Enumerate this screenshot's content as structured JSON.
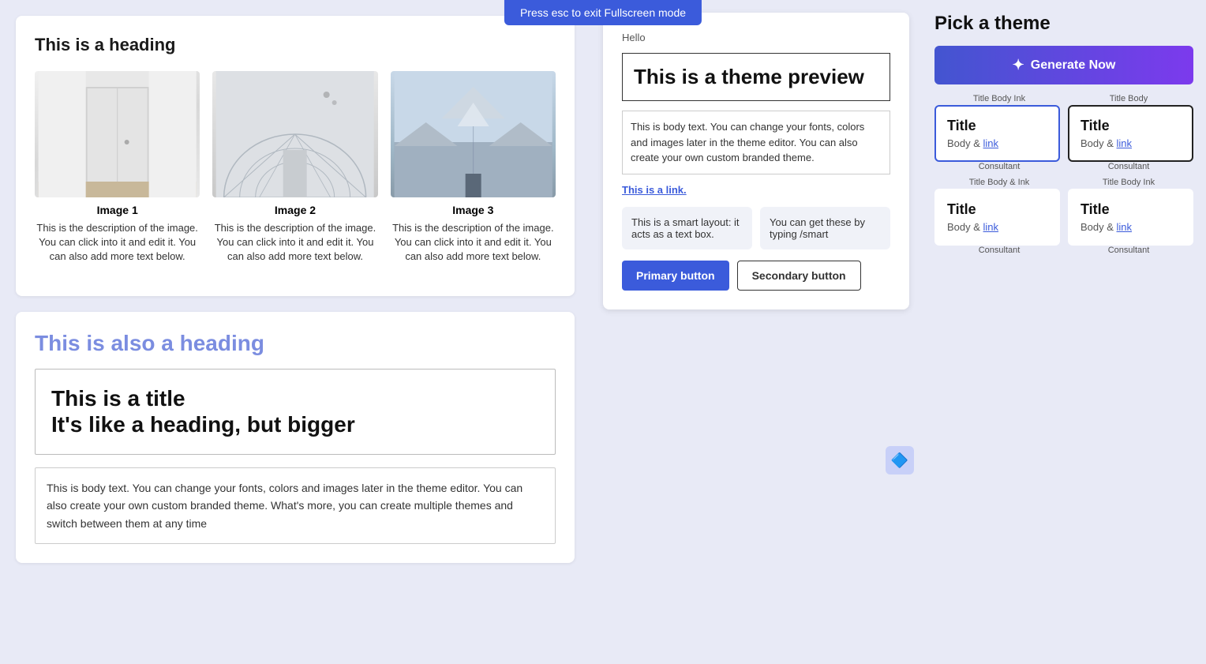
{
  "topbar": {
    "message": "Press esc to exit Fullscreen mode"
  },
  "editor": {
    "card1": {
      "heading": "This is a heading",
      "images": [
        {
          "label": "Image 1",
          "description": "This is the description of the image. You can click into it and edit it. You can also add more text below.",
          "type": "door"
        },
        {
          "label": "Image 2",
          "description": "This is the description of the image. You can click into it and edit it. You can also add more text below.",
          "type": "arch"
        },
        {
          "label": "Image 3",
          "description": "This is the description of the image. You can click into it and edit it. You can also add more text below.",
          "type": "mountain"
        }
      ]
    },
    "card2": {
      "also_heading": "This is also a heading",
      "title_line1": "This is a title",
      "title_line2": "It's like a heading, but bigger",
      "body_text": "This is body text. You can change your fonts, colors and images later in the theme editor. You can also create your own custom branded theme. What's more, you can create multiple themes and switch between them at any time"
    }
  },
  "right_panel": {
    "title": "Pick a theme",
    "generate_btn": "Generate Now",
    "themes": [
      {
        "title": "Title",
        "body": "Body & link",
        "label": "Consultant",
        "selected": true,
        "dark_border": false
      },
      {
        "title": "Title",
        "body": "Body & link",
        "label": "Consultant",
        "selected": false,
        "dark_border": true
      },
      {
        "title": "Title",
        "body": "Body & link",
        "label": "Consultant",
        "selected": false,
        "dark_border": false
      },
      {
        "title": "Title",
        "body": "Body & link",
        "label": "Consultant",
        "selected": false,
        "dark_border": false
      }
    ],
    "top_section_labels": [
      "Title Body Ink",
      "Title Body"
    ],
    "bottom_section_labels": [
      "Title Body & Ink",
      "Title Body Ink"
    ]
  },
  "preview": {
    "hello": "Hello",
    "heading": "This is a theme preview",
    "body_text": "This is body text. You can change your fonts, colors and images later in the theme editor. You can also create your own custom branded theme.",
    "link_text": "This is a link.",
    "smart_boxes": [
      "This is a smart layout: it acts as a text box.",
      "You can get these by typing /smart"
    ],
    "primary_btn": "Primary button",
    "secondary_btn": "Secondary button"
  }
}
